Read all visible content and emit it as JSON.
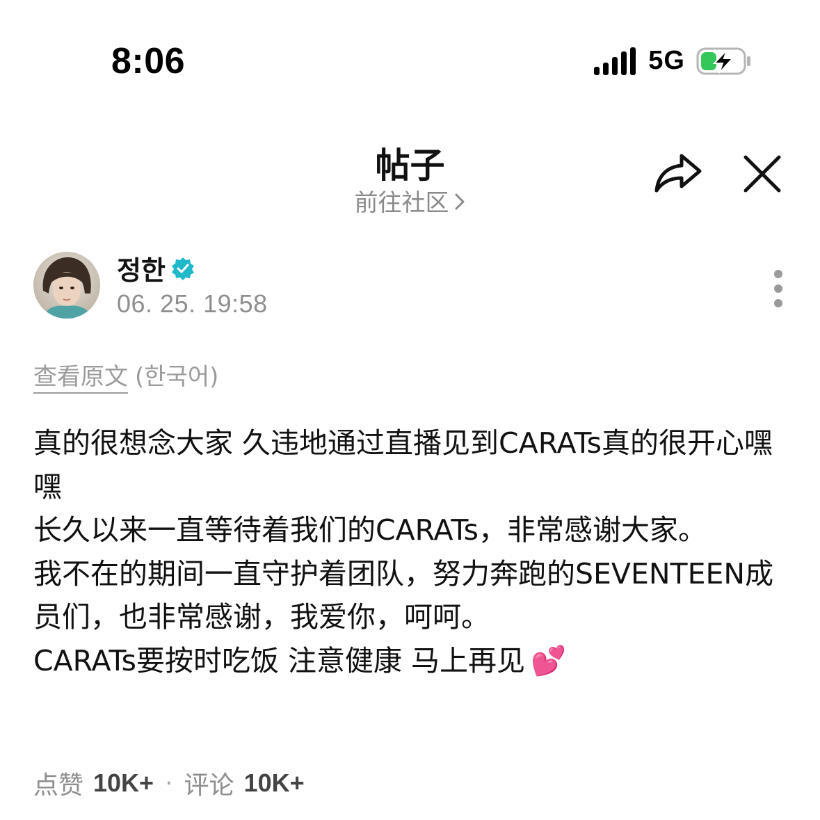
{
  "status_bar": {
    "time": "8:06",
    "network": "5G",
    "battery_state": "charging"
  },
  "header": {
    "title": "帖子",
    "community_link": "前往社区",
    "share_icon": "share-arrow-icon",
    "close_icon": "close-icon"
  },
  "author": {
    "name": "정한",
    "verified": true,
    "posted_at": "06. 25. 19:58",
    "more_icon": "more-vertical-icon"
  },
  "translation": {
    "view_original_label": "查看原文",
    "original_language": "(한국어)"
  },
  "post": {
    "lines": [
      "真的很想念大家 久违地通过直播见到CARATs真的很开心嘿嘿",
      "长久以来一直等待着我们的CARATs，非常感谢大家。",
      "我不在的期间一直守护着团队，努力奔跑的SEVENTEEN成员们，也非常感谢，我爱你，呵呵。",
      "CARATs要按时吃饭 注意健康 马上再见"
    ],
    "emoji": "💕"
  },
  "stats": {
    "likes_label": "点赞",
    "likes_count": "10K+",
    "separator": "·",
    "comments_label": "评论",
    "comments_count": "10K+"
  },
  "colors": {
    "verified_badge": "#1fb9c9",
    "muted_text": "#8e8e8e",
    "battery_green": "#34c759"
  }
}
